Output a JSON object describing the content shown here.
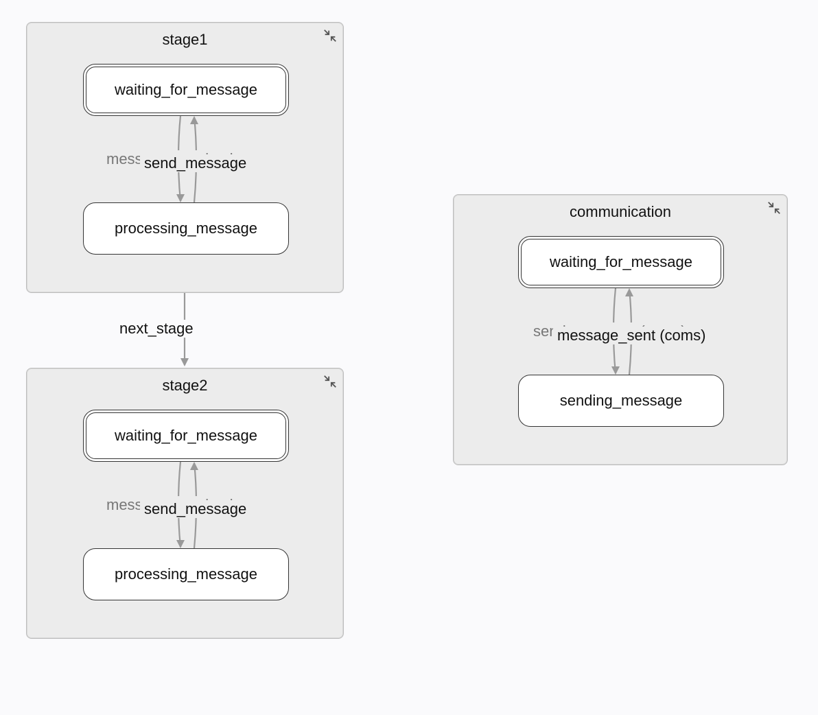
{
  "diagram": {
    "containers": {
      "stage1": {
        "title": "stage1",
        "states": {
          "waiting": {
            "label": "waiting_for_message",
            "initial": true
          },
          "processing": {
            "label": "processing_message",
            "initial": false
          }
        },
        "transitions": {
          "down": "message_received",
          "up": "send_message"
        }
      },
      "stage2": {
        "title": "stage2",
        "states": {
          "waiting": {
            "label": "waiting_for_message",
            "initial": true
          },
          "processing": {
            "label": "processing_message",
            "initial": false
          }
        },
        "transitions": {
          "down": "message_received",
          "up": "send_message"
        }
      },
      "communication": {
        "title": "communication",
        "states": {
          "waiting": {
            "label": "waiting_for_message",
            "initial": true
          },
          "sending": {
            "label": "sending_message",
            "initial": false
          }
        },
        "transitions": {
          "down": "send_message (coms)",
          "up": "message_sent (coms)"
        }
      }
    },
    "interTransitions": {
      "stage1_to_stage2": "next_stage"
    }
  }
}
